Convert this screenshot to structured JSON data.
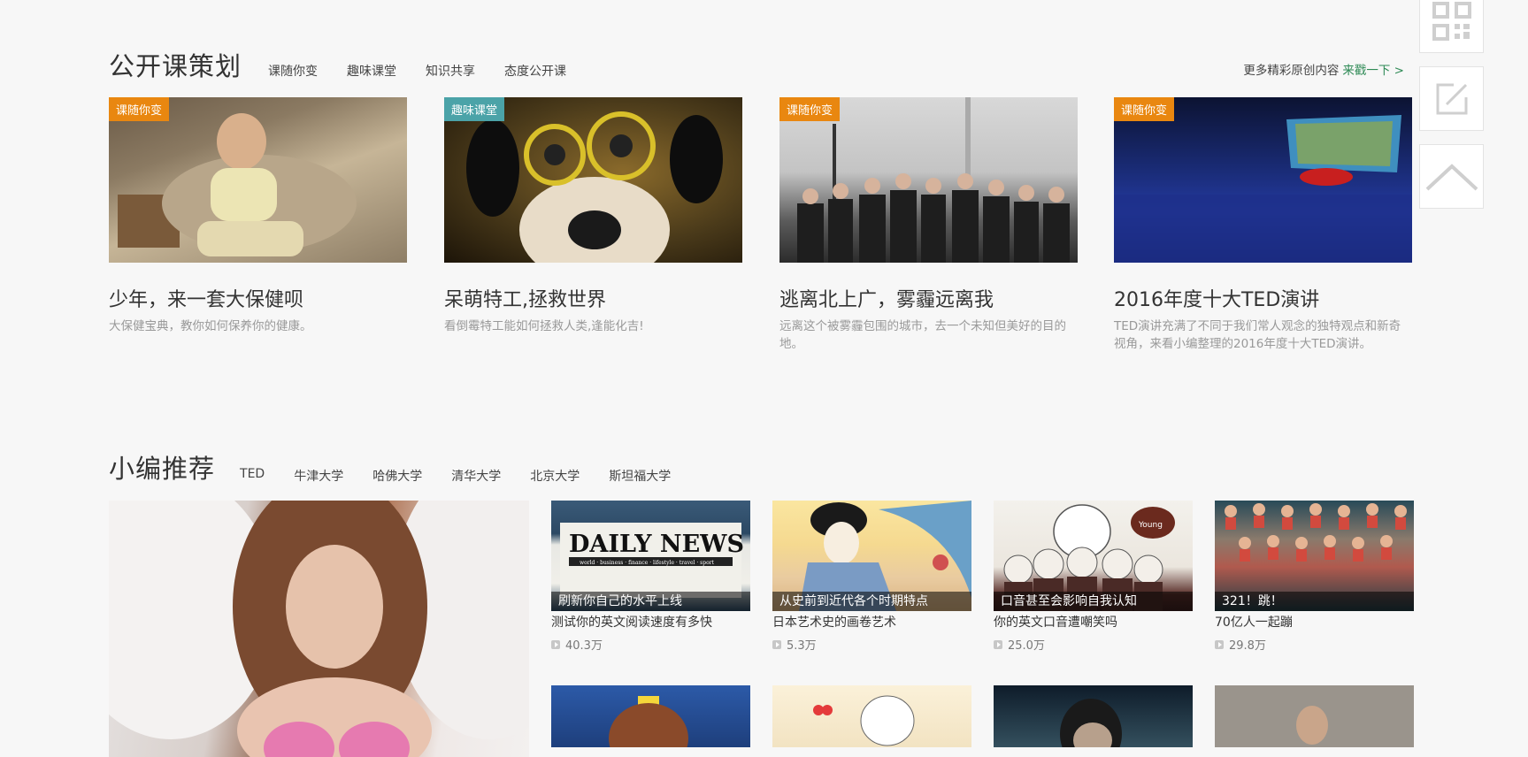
{
  "section1": {
    "title": "公开课策划",
    "tabs": [
      "课随你变",
      "趣味课堂",
      "知识共享",
      "态度公开课"
    ],
    "more_text": "更多精彩原创内容",
    "more_link": "来戳一下 >",
    "cards": [
      {
        "tag": "课随你变",
        "tag_color": "#e98710",
        "title": "少年，来一套大保健呗",
        "desc": "大保健宝典，教你如何保养你的健康。"
      },
      {
        "tag": "趣味课堂",
        "tag_color": "#4ba3a8",
        "title": "呆萌特工,拯救世界",
        "desc": "看倒霉特工能如何拯救人类,逢能化吉!"
      },
      {
        "tag": "课随你变",
        "tag_color": "#e98710",
        "title": "逃离北上广，雾霾远离我",
        "desc": "远离这个被雾霾包围的城市，去一个未知但美好的目的地。"
      },
      {
        "tag": "课随你变",
        "tag_color": "#e98710",
        "title": "2016年度十大TED演讲",
        "desc": "TED演讲充满了不同于我们常人观念的独特观点和新奇视角，来看小编整理的2016年度十大TED演讲。"
      }
    ]
  },
  "section2": {
    "title": "小编推荐",
    "tabs": [
      "TED",
      "牛津大学",
      "哈佛大学",
      "清华大学",
      "北京大学",
      "斯坦福大学"
    ],
    "videos": [
      {
        "caption": "刷新你自己的水平上线",
        "title": "测试你的英文阅读速度有多快",
        "views": "40.3万",
        "newspaper": "DAILY NEWS",
        "newspaper_sub": "world · business · finance · lifestyle · travel · sport"
      },
      {
        "caption": "从史前到近代各个时期特点",
        "title": "日本艺术史的画卷艺术",
        "views": "5.3万"
      },
      {
        "caption": "口音甚至会影响自我认知",
        "title": "你的英文口音遭嘲笑吗",
        "views": "25.0万",
        "bubble": "Young"
      },
      {
        "caption": "321！跳！",
        "title": "70亿人一起蹦",
        "views": "29.8万"
      }
    ]
  },
  "tools": {
    "qr": "qr-code-icon",
    "edit": "edit-icon",
    "top": "back-to-top-icon"
  }
}
